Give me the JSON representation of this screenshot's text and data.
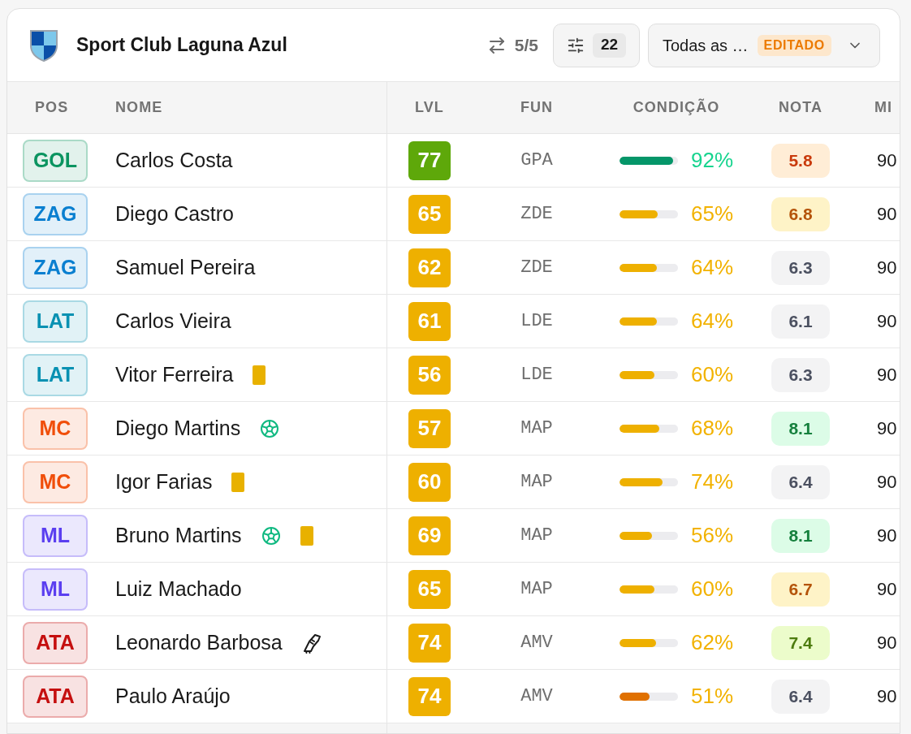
{
  "header": {
    "title": "Sport Club Laguna Azul",
    "swap_count": "5/5",
    "filter_count": "22",
    "view": {
      "label": "Todas as …",
      "badge": "EDITADO"
    }
  },
  "table": {
    "columns": [
      "POS",
      "NOME",
      "LVL",
      "FUN",
      "CONDIÇÃO",
      "NOTA",
      "MI"
    ],
    "rows": [
      {
        "pos": {
          "label": "GOL",
          "color": "#0b9460"
        },
        "name": "Carlos Costa",
        "lvl": {
          "value": "77",
          "color": "#5ea80a"
        },
        "fun": "GPA",
        "condition": {
          "bar": {
            "level": 0.92,
            "color": "#059669"
          },
          "reading": {
            "text": "92%",
            "color": "#17d48f"
          }
        },
        "nota": {
          "value": "5.8",
          "kind": "poor"
        },
        "min": "90"
      },
      {
        "pos": {
          "label": "ZAG",
          "color": "#0a7fd0"
        },
        "name": "Diego Castro",
        "lvl": {
          "value": "65",
          "color": "#eeb000"
        },
        "fun": "ZDE",
        "condition": {
          "bar": {
            "level": 0.65,
            "color": "#eeb000"
          },
          "reading": {
            "text": "65%",
            "color": "#f2b200"
          }
        },
        "nota": {
          "value": "6.8",
          "kind": "fair"
        },
        "min": "90"
      },
      {
        "pos": {
          "label": "ZAG",
          "color": "#0a7fd0"
        },
        "name": "Samuel Pereira",
        "lvl": {
          "value": "62",
          "color": "#eeb000"
        },
        "fun": "ZDE",
        "condition": {
          "bar": {
            "level": 0.64,
            "color": "#eeb000"
          },
          "reading": {
            "text": "64%",
            "color": "#f2b200"
          }
        },
        "nota": {
          "value": "6.3",
          "kind": "average"
        },
        "min": "90"
      },
      {
        "pos": {
          "label": "LAT",
          "color": "#0891b2"
        },
        "name": "Carlos Vieira",
        "lvl": {
          "value": "61",
          "color": "#eeb000"
        },
        "fun": "LDE",
        "condition": {
          "bar": {
            "level": 0.64,
            "color": "#eeb000"
          },
          "reading": {
            "text": "64%",
            "color": "#f2b200"
          }
        },
        "nota": {
          "value": "6.1",
          "kind": "average"
        },
        "min": "90"
      },
      {
        "pos": {
          "label": "LAT",
          "color": "#0891b2"
        },
        "name": "Vitor Ferreira",
        "events": [
          {
            "kind": "card"
          }
        ],
        "lvl": {
          "value": "56",
          "color": "#eeb000"
        },
        "fun": "LDE",
        "condition": {
          "bar": {
            "level": 0.6,
            "color": "#eeb000"
          },
          "reading": {
            "text": "60%",
            "color": "#f2b200"
          }
        },
        "nota": {
          "value": "6.3",
          "kind": "average"
        },
        "min": "90"
      },
      {
        "pos": {
          "label": "MC",
          "color": "#f04e0a"
        },
        "name": "Diego Martins",
        "events": [
          {
            "kind": "goal"
          }
        ],
        "lvl": {
          "value": "57",
          "color": "#eeb000"
        },
        "fun": "MAP",
        "condition": {
          "bar": {
            "level": 0.68,
            "color": "#eeb000"
          },
          "reading": {
            "text": "68%",
            "color": "#f2b200"
          }
        },
        "nota": {
          "value": "8.1",
          "kind": "great"
        },
        "min": "90"
      },
      {
        "pos": {
          "label": "MC",
          "color": "#f04e0a"
        },
        "name": "Igor Farias",
        "events": [
          {
            "kind": "card"
          }
        ],
        "lvl": {
          "value": "60",
          "color": "#eeb000"
        },
        "fun": "MAP",
        "condition": {
          "bar": {
            "level": 0.74,
            "color": "#eeb000"
          },
          "reading": {
            "text": "74%",
            "color": "#f2b200"
          }
        },
        "nota": {
          "value": "6.4",
          "kind": "average"
        },
        "min": "90"
      },
      {
        "pos": {
          "label": "ML",
          "color": "#5b3ff0"
        },
        "name": "Bruno Martins",
        "events": [
          {
            "kind": "goal"
          },
          {
            "kind": "card"
          }
        ],
        "lvl": {
          "value": "69",
          "color": "#eeb000"
        },
        "fun": "MAP",
        "condition": {
          "bar": {
            "level": 0.56,
            "color": "#eeb000"
          },
          "reading": {
            "text": "56%",
            "color": "#f2b200"
          }
        },
        "nota": {
          "value": "8.1",
          "kind": "great"
        },
        "min": "90"
      },
      {
        "pos": {
          "label": "ML",
          "color": "#5b3ff0"
        },
        "name": "Luiz Machado",
        "lvl": {
          "value": "65",
          "color": "#eeb000"
        },
        "fun": "MAP",
        "condition": {
          "bar": {
            "level": 0.6,
            "color": "#eeb000"
          },
          "reading": {
            "text": "60%",
            "color": "#f2b200"
          }
        },
        "nota": {
          "value": "6.7",
          "kind": "fair"
        },
        "min": "90"
      },
      {
        "pos": {
          "label": "ATA",
          "color": "#c50f0f"
        },
        "name": "Leonardo Barbosa",
        "events": [
          {
            "kind": "boot"
          }
        ],
        "lvl": {
          "value": "74",
          "color": "#eeb000"
        },
        "fun": "AMV",
        "condition": {
          "bar": {
            "level": 0.62,
            "color": "#eeb000"
          },
          "reading": {
            "text": "62%",
            "color": "#f2b200"
          }
        },
        "nota": {
          "value": "7.4",
          "kind": "good"
        },
        "min": "90"
      },
      {
        "pos": {
          "label": "ATA",
          "color": "#c50f0f"
        },
        "name": "Paulo Araújo",
        "lvl": {
          "value": "74",
          "color": "#eeb000"
        },
        "fun": "AMV",
        "condition": {
          "bar": {
            "level": 0.51,
            "color": "#e07000"
          },
          "reading": {
            "text": "51%",
            "color": "#f2b200"
          }
        },
        "nota": {
          "value": "6.4",
          "kind": "average"
        },
        "min": "90"
      }
    ]
  }
}
